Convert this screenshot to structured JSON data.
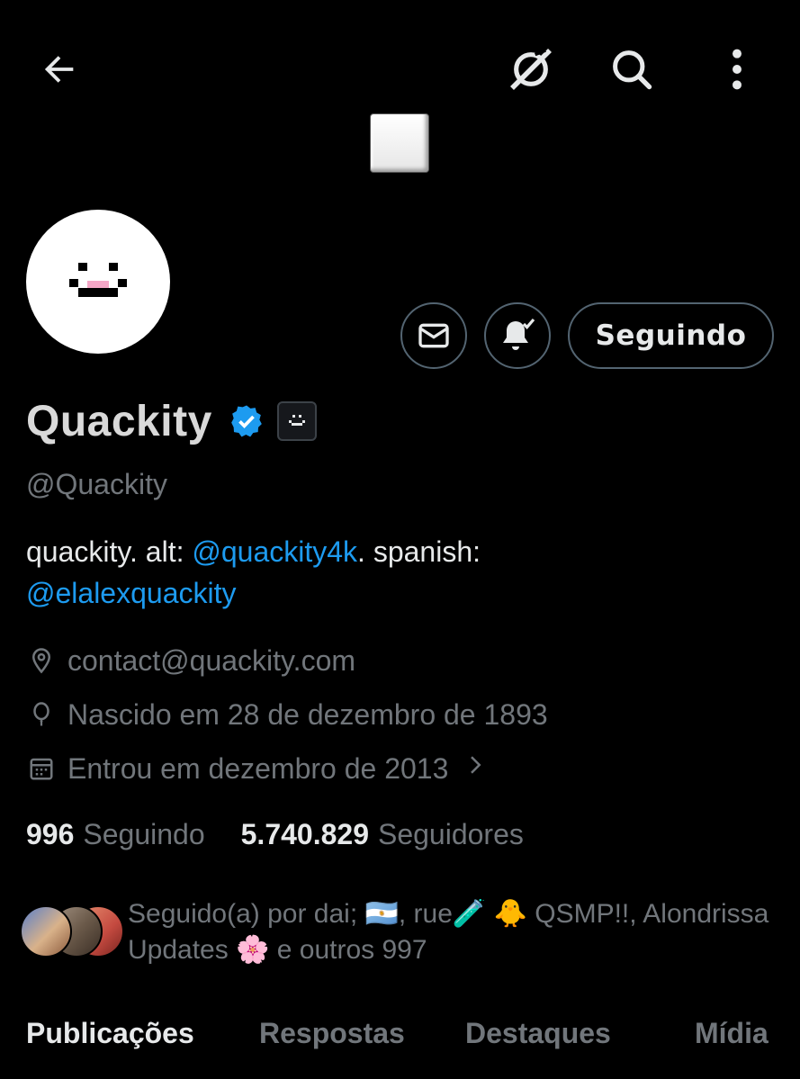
{
  "topbar": {
    "back_icon": "arrow-left-icon",
    "grok_icon": "grok-icon",
    "search_icon": "search-icon",
    "more_icon": "more-vertical-icon"
  },
  "profile": {
    "name": "Quackity",
    "handle": "@Quackity",
    "bio": {
      "part1": "quackity. alt: ",
      "mention1": "@quackity4k",
      "part2": ". spanish:",
      "mention2": "@elalexquackity"
    },
    "contact": "contact@quackity.com",
    "born": "Nascido em 28 de dezembro de 1893",
    "joined": "Entrou em dezembro de 2013",
    "following_count": "996",
    "following_label": "Seguindo",
    "followers_count": "5.740.829",
    "followers_label": "Seguidores",
    "followed_by": "Seguido(a) por dai; 🇦🇷, rue🧪 🐥 QSMP!!, Alondrissa Updates 🌸 e outros 997"
  },
  "actions": {
    "message_icon": "envelope-icon",
    "bell_icon": "bell-check-icon",
    "follow_label": "Seguindo"
  },
  "tabs": [
    {
      "label": "Publicações",
      "active": true
    },
    {
      "label": "Respostas",
      "active": false
    },
    {
      "label": "Destaques",
      "active": false
    },
    {
      "label": "Mídia",
      "active": false
    }
  ],
  "colors": {
    "background": "#000000",
    "link": "#1d9bf0",
    "muted": "#71767b",
    "text": "#e7e9ea",
    "verified": "#1d9bf0"
  }
}
